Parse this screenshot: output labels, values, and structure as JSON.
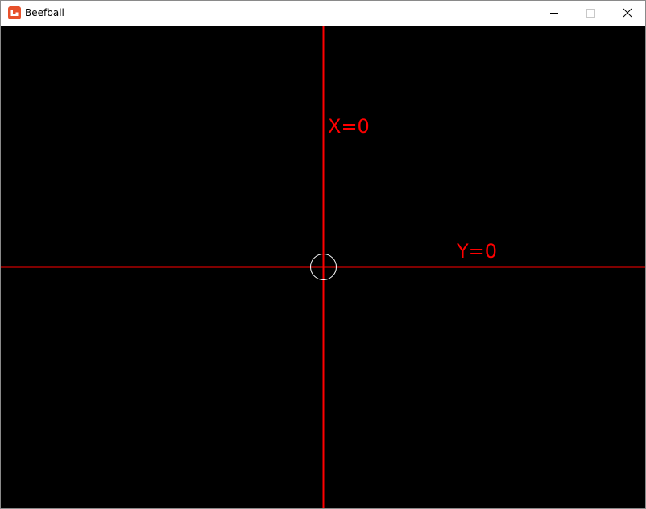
{
  "window": {
    "title": "Beefball",
    "app_icon": "monogame-icon",
    "controls": {
      "minimize_icon": "minimize-icon",
      "maximize_icon": "maximize-icon",
      "close_icon": "close-icon"
    }
  },
  "game": {
    "background_color": "#000000",
    "axis_color": "#ff0000",
    "ball_color": "#ffffff",
    "x_axis_label": "X=0",
    "y_axis_label": "Y=0"
  }
}
